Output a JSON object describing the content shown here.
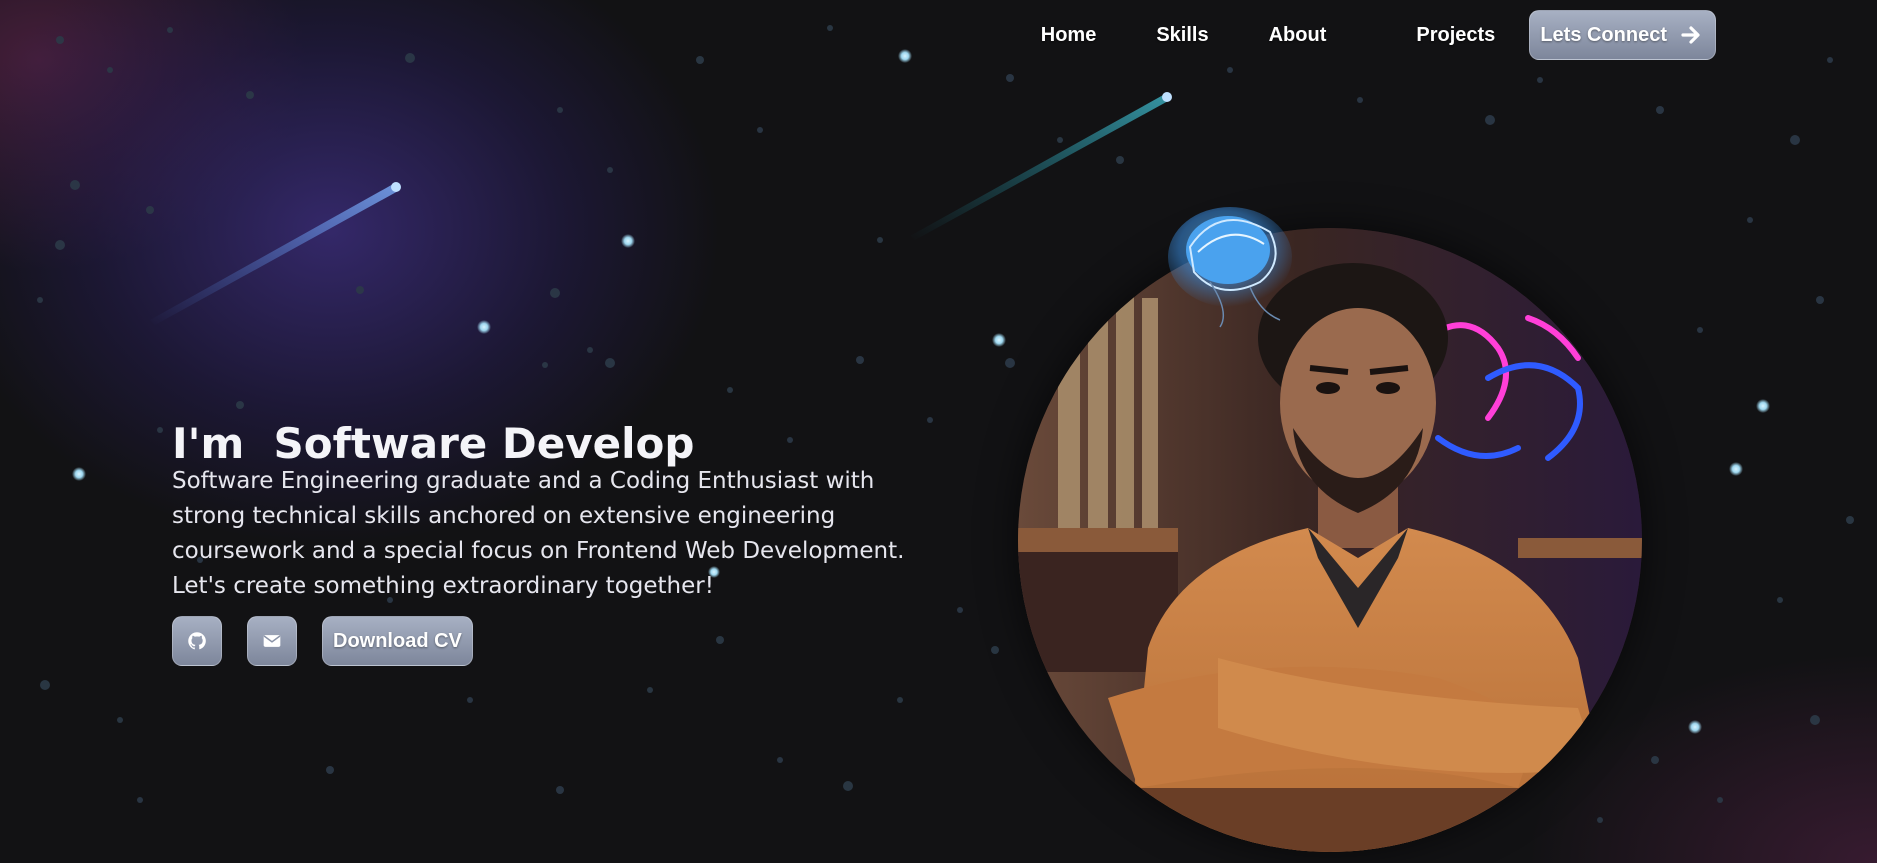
{
  "nav": {
    "links": [
      {
        "label": "Home"
      },
      {
        "label": "Skills"
      },
      {
        "label": "About"
      },
      {
        "label": "Projects"
      }
    ],
    "cta_label": "Lets Connect",
    "cta_icon": "arrow-right-icon"
  },
  "hero": {
    "title": "I'm  Software Develop",
    "description": "Software Engineering graduate and a Coding Enthusiast with strong technical skills anchored on extensive engineering coursework and a special focus on Frontend Web Development. Let's create something extraordinary together!",
    "buttons": {
      "github_icon": "github-icon",
      "mail_icon": "envelope-icon",
      "cv_label": "Download CV"
    }
  },
  "colors": {
    "background": "#121214",
    "button_top": "#a7b0c3",
    "button_bottom": "#7d869b",
    "glow_purple": "#3a2c78",
    "star": "#9fd8f0"
  }
}
